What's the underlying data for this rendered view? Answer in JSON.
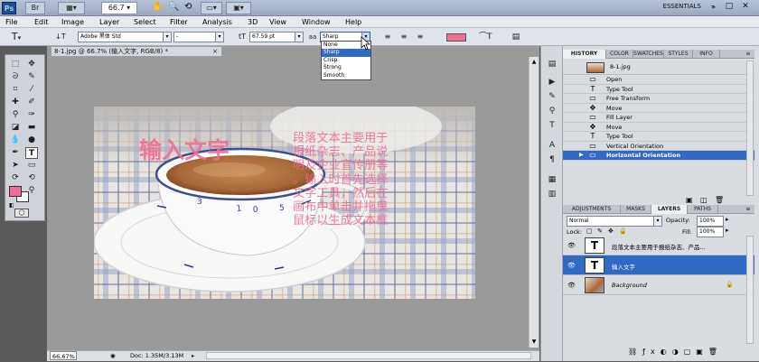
{
  "titlebar": {
    "logo": "Ps",
    "zoom": "66.7",
    "workspace": "ESSENTIALS",
    "minimize": "–",
    "maximize": "□",
    "close": "✕"
  },
  "menu": [
    "File",
    "Edit",
    "Image",
    "Layer",
    "Select",
    "Filter",
    "Analysis",
    "3D",
    "View",
    "Window",
    "Help"
  ],
  "options": {
    "tool_glyph": "T",
    "orient_glyph": "↓T",
    "font_family": "Adobe 黑体 Std",
    "font_style": "-",
    "size_glyph": "tT",
    "font_size": "67.59 pt",
    "aa_glyph": "aa",
    "aa_value": "Sharp",
    "aa_options": [
      "None",
      "Sharp",
      "Crisp",
      "Strong",
      "Smooth"
    ],
    "aa_selected_index": 1,
    "text_color": "#ef6e95"
  },
  "document": {
    "tab_title": "8-1.jpg @ 66.7% (输入文字, RGB/8) *",
    "tab_close": "×",
    "canvas_title_text": "输入文字",
    "canvas_body_text": [
      "段落文本主要用于",
      "报纸杂志、产品说",
      "明及企业宣传册等",
      "。输入时首先选择",
      "文字工具，然后在",
      "画布中单击并拖曳",
      "鼠标以生成文本框"
    ],
    "text_color": "#ef6e95"
  },
  "status": {
    "zoom": "66.67%",
    "doc": "Doc: 1.35M/3.13M"
  },
  "history": {
    "tabs": [
      "HISTORY",
      "COLOR",
      "SWATCHES",
      "STYLES",
      "INFO"
    ],
    "snapshot": "8-1.jpg",
    "items": [
      {
        "label": "Open",
        "icon": "▭"
      },
      {
        "label": "Type Tool",
        "icon": "T"
      },
      {
        "label": "Free Transform",
        "icon": "▭"
      },
      {
        "label": "Move",
        "icon": "✥"
      },
      {
        "label": "Fill Layer",
        "icon": "▭"
      },
      {
        "label": "Move",
        "icon": "✥"
      },
      {
        "label": "Type Tool",
        "icon": "T"
      },
      {
        "label": "Vertical Orientation",
        "icon": "▭"
      },
      {
        "label": "Horizontal Orientation",
        "icon": "▭"
      }
    ],
    "selected_index": 8
  },
  "layers": {
    "tabs": [
      "ADJUSTMENTS",
      "MASKS",
      "LAYERS",
      "PATHS"
    ],
    "blend_mode": "Normal",
    "opacity_label": "Opacity:",
    "opacity": "100%",
    "lock_label": "Lock:",
    "fill_label": "Fill:",
    "fill": "100%",
    "items": [
      {
        "name": "段落文本主要用于报纸杂志、产品...",
        "type": "text"
      },
      {
        "name": "输入文字",
        "type": "text"
      },
      {
        "name": "Background",
        "type": "image"
      }
    ],
    "selected_index": 1
  }
}
